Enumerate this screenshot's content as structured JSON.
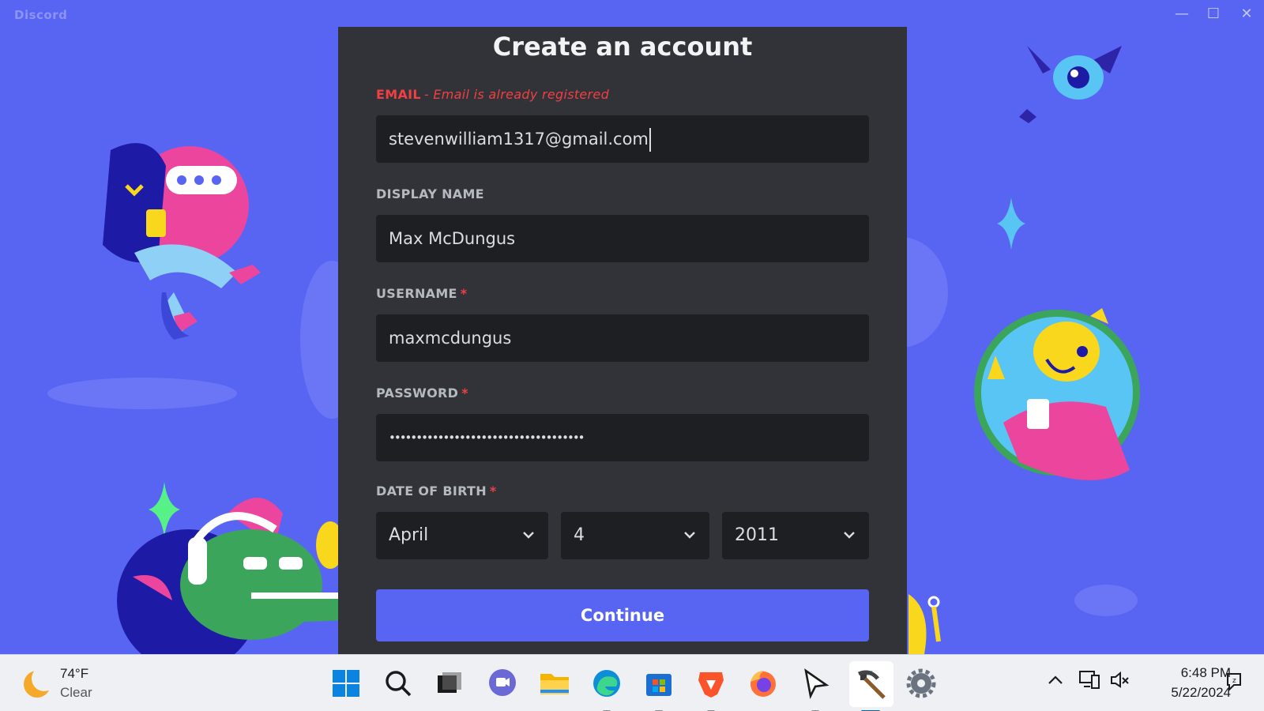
{
  "window": {
    "app_name": "Discord",
    "controls": {
      "minimize": "—",
      "maximize": "☐",
      "close": "✕"
    }
  },
  "modal": {
    "title": "Create an account",
    "email": {
      "label": "EMAIL",
      "error": "- Email is already registered",
      "value": "stevenwilliam1317@gmail.com"
    },
    "display_name": {
      "label": "DISPLAY NAME",
      "value": "Max McDungus"
    },
    "username": {
      "label": "USERNAME",
      "required": "*",
      "value": "maxmcdungus"
    },
    "password": {
      "label": "PASSWORD",
      "required": "*",
      "value": "••••••••••••••••••••••••••••••••••••"
    },
    "date_of_birth": {
      "label": "DATE OF BIRTH",
      "required": "*",
      "month": "April",
      "day": "4",
      "year": "2011"
    },
    "continue_label": "Continue"
  },
  "colors": {
    "background": "#5865F2",
    "modal": "#313338",
    "input": "#1e1f22",
    "error": "#f23f43",
    "button": "#5865F2"
  },
  "taskbar": {
    "weather": {
      "temp": "74°F",
      "condition": "Clear",
      "icon": "moon-icon"
    },
    "apps": [
      {
        "name": "windows-start-icon"
      },
      {
        "name": "search-icon"
      },
      {
        "name": "task-view-icon"
      },
      {
        "name": "teams-chat-icon"
      },
      {
        "name": "file-explorer-icon"
      },
      {
        "name": "edge-browser-icon"
      },
      {
        "name": "microsoft-store-icon"
      },
      {
        "name": "brave-browser-icon"
      },
      {
        "name": "firefox-icon"
      },
      {
        "name": "cursor-app-icon"
      },
      {
        "name": "minecraft-icon"
      },
      {
        "name": "settings-gear-icon"
      }
    ],
    "clock": {
      "time": "6:48 PM",
      "date": "5/22/2024"
    }
  }
}
